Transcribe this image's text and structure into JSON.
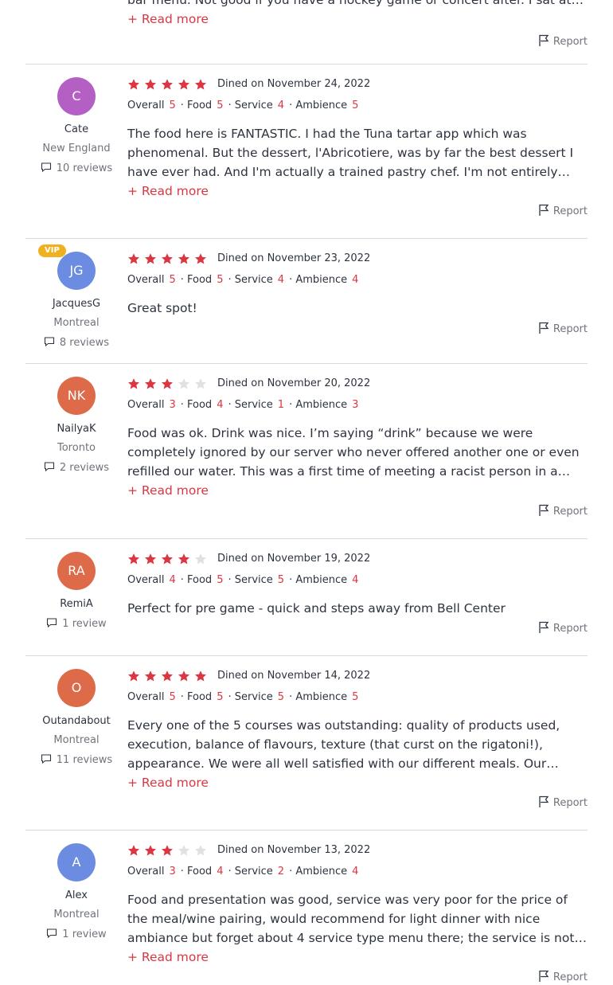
{
  "labels": {
    "overall": "Overall",
    "food": "Food",
    "service": "Service",
    "ambience": "Ambience",
    "read_more": "+ Read more",
    "report": "Report"
  },
  "colors": {
    "star_filled": "#da3743",
    "star_empty": "#e1e1e1",
    "accent": "#da3743",
    "vip": "#f0b120"
  },
  "top_partial": {
    "text": "bar menu. Not good if you have a hockey game or concert after. I sat at the bar..."
  },
  "reviews": [
    {
      "initials": "C",
      "avatar_color": "#b45fc4",
      "vip": false,
      "name": "Cate",
      "location": "New England",
      "review_count": "10 reviews",
      "stars": 5,
      "dined": "Dined on November 24, 2022",
      "overall": "5",
      "food": "5",
      "service": "4",
      "ambience": "5",
      "text": "The food here is FANTASTIC. I had the Tuna tartar app which was phenomenal. But the dessert, l'Abricotiere, was by far the best dessert I have ever had. And I'm actually a trained pastry chef. I'm not entirely sure I'll ever be able to eat dessert anywhere else again.",
      "read_more": true
    },
    {
      "initials": "JG",
      "avatar_color": "#6b8ce0",
      "vip": true,
      "vip_label": "VIP",
      "name": "JacquesG",
      "location": "Montreal",
      "review_count": "8 reviews",
      "stars": 5,
      "dined": "Dined on November 23, 2022",
      "overall": "5",
      "food": "5",
      "service": "4",
      "ambience": "4",
      "text": "Great spot!",
      "read_more": false
    },
    {
      "initials": "NK",
      "avatar_color": "#dd6a48",
      "vip": false,
      "name": "NailyaK",
      "location": "Toronto",
      "review_count": "2 reviews",
      "stars": 3,
      "dined": "Dined on November 20, 2022",
      "overall": "3",
      "food": "4",
      "service": "1",
      "ambience": "3",
      "text": "Food was ok. Drink was nice. I’m saying “drink” because we were completely ignored by our server who never offered another one or even refilled our water. This was a first time of meeting a racist person in a restaurant setting. He was very rude and dismissive.",
      "read_more": true
    },
    {
      "initials": "RA",
      "avatar_color": "#dd6a48",
      "vip": false,
      "name": "RemiA",
      "location": "",
      "review_count": "1 review",
      "stars": 4,
      "dined": "Dined on November 19, 2022",
      "overall": "4",
      "food": "5",
      "service": "5",
      "ambience": "4",
      "text": "Perfect for pre game - quick and steps away from Bell Center",
      "read_more": false
    },
    {
      "initials": "O",
      "avatar_color": "#dd6a48",
      "vip": false,
      "name": "Outandabout",
      "location": "Montreal",
      "review_count": "11 reviews",
      "stars": 5,
      "dined": "Dined on November 14, 2022",
      "overall": "5",
      "food": "5",
      "service": "5",
      "ambience": "5",
      "text": "Every one of the 5 courses was outstanding: quality of products used, execution, balance of flavours, texture (that curst on the rigatoni!), appearance. We were all well satisfied with our different meals. Our waiter, Dominique, provided friendly and attentive service.",
      "read_more": true
    },
    {
      "initials": "A",
      "avatar_color": "#6b8ce0",
      "vip": false,
      "name": "Alex",
      "location": "Montreal",
      "review_count": "1 review",
      "stars": 3,
      "dined": "Dined on November 13, 2022",
      "overall": "3",
      "food": "4",
      "service": "2",
      "ambience": "4",
      "text": "Food and presentation was good, service was very poor for the price of the meal/wine pairing, would recommend for light dinner with nice ambiance but forget about 4 service type menu there; the service is not up to the kitchen's standards.",
      "read_more": true
    }
  ]
}
